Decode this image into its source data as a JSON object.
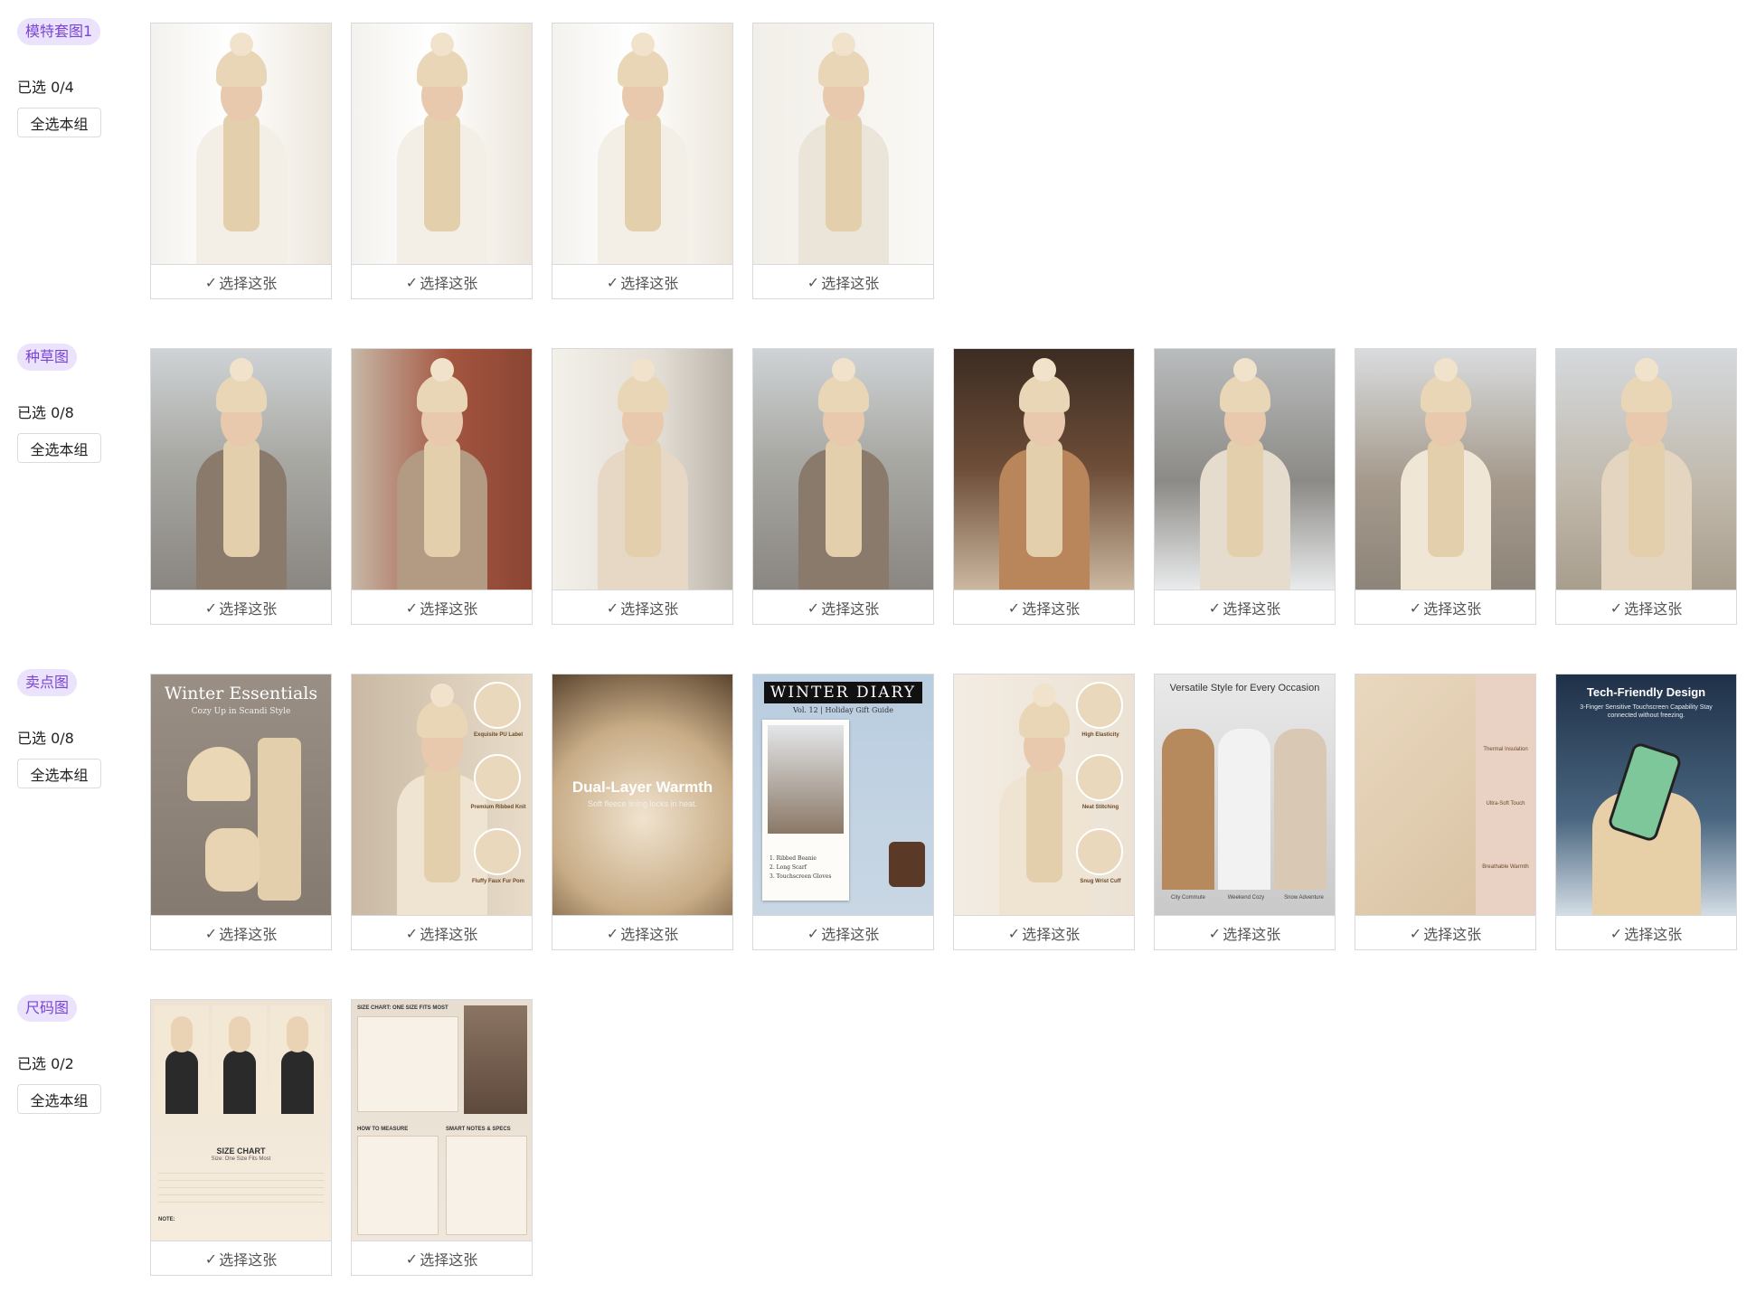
{
  "colors": {
    "tag_bg": "#ebe2fb",
    "tag_text": "#7a45d6",
    "card_border": "#d9d9d9"
  },
  "icons": {
    "check": "check-icon"
  },
  "pick_label": "选择这张",
  "select_all_label": "全选本组",
  "groups": [
    {
      "tag": "模特套图1",
      "count": "已选 0/4",
      "cards": [
        {
          "scene": "studio",
          "texts": {}
        },
        {
          "scene": "studio",
          "texts": {}
        },
        {
          "scene": "studio",
          "texts": {}
        },
        {
          "scene": "studio-close",
          "texts": {}
        }
      ]
    },
    {
      "tag": "种草图",
      "count": "已选 0/8",
      "cards": [
        {
          "scene": "street",
          "texts": {}
        },
        {
          "scene": "brick",
          "texts": {}
        },
        {
          "scene": "window",
          "texts": {}
        },
        {
          "scene": "street",
          "texts": {}
        },
        {
          "scene": "cafe",
          "texts": {}
        },
        {
          "scene": "park-snow",
          "texts": {}
        },
        {
          "scene": "lane",
          "texts": {}
        },
        {
          "scene": "balcony",
          "texts": {}
        }
      ]
    },
    {
      "tag": "卖点图",
      "count": "已选 0/8",
      "cards": [
        {
          "scene": "flatlay",
          "texts": {
            "title": "Winter Essentials",
            "sub": "Cozy Up in Scandi Style"
          }
        },
        {
          "scene": "features",
          "texts": {
            "f1": "Exquisite PU Label",
            "f2": "Premium Ribbed Knit",
            "f3": "Fluffy Faux Fur Pom"
          }
        },
        {
          "scene": "fleece",
          "texts": {
            "title": "Dual-Layer Warmth",
            "sub": "Soft fleece lining locks in heat."
          }
        },
        {
          "scene": "diary",
          "texts": {
            "title": "WINTER DIARY",
            "sub": "Vol. 12 | Holiday Gift Guide",
            "l1": "1. Ribbed Beanie",
            "l2": "2. Long Scarf",
            "l3": "3. Touchscreen Gloves"
          }
        },
        {
          "scene": "features2",
          "texts": {
            "f1": "High Elasticity",
            "f2": "Neat Stitching",
            "f3": "Snug Wrist Cuff"
          }
        },
        {
          "scene": "versatile",
          "texts": {
            "title": "Versatile Style for Every Occasion",
            "c1": "City Commute",
            "c2": "Weekend Cozy",
            "c3": "Snow Adventure"
          }
        },
        {
          "scene": "texture",
          "texts": {
            "f1": "Thermal Insulation",
            "f2": "Ultra-Soft Touch",
            "f3": "Breathable Warmth"
          }
        },
        {
          "scene": "tech",
          "texts": {
            "title": "Tech-Friendly Design",
            "sub": "3-Finger Sensitive Touchscreen Capability Stay connected without freezing."
          }
        }
      ]
    },
    {
      "tag": "尺码图",
      "count": "已选 0/2",
      "cards": [
        {
          "scene": "sizechart",
          "texts": {
            "title": "SIZE CHART",
            "sub": "Size: One Size Fits Most",
            "note": "NOTE:"
          }
        },
        {
          "scene": "sizechart2",
          "texts": {
            "title": "SIZE CHART: ONE SIZE FITS MOST",
            "h1": "HOW TO MEASURE",
            "h2": "SMART NOTES & SPECS"
          }
        }
      ]
    }
  ]
}
